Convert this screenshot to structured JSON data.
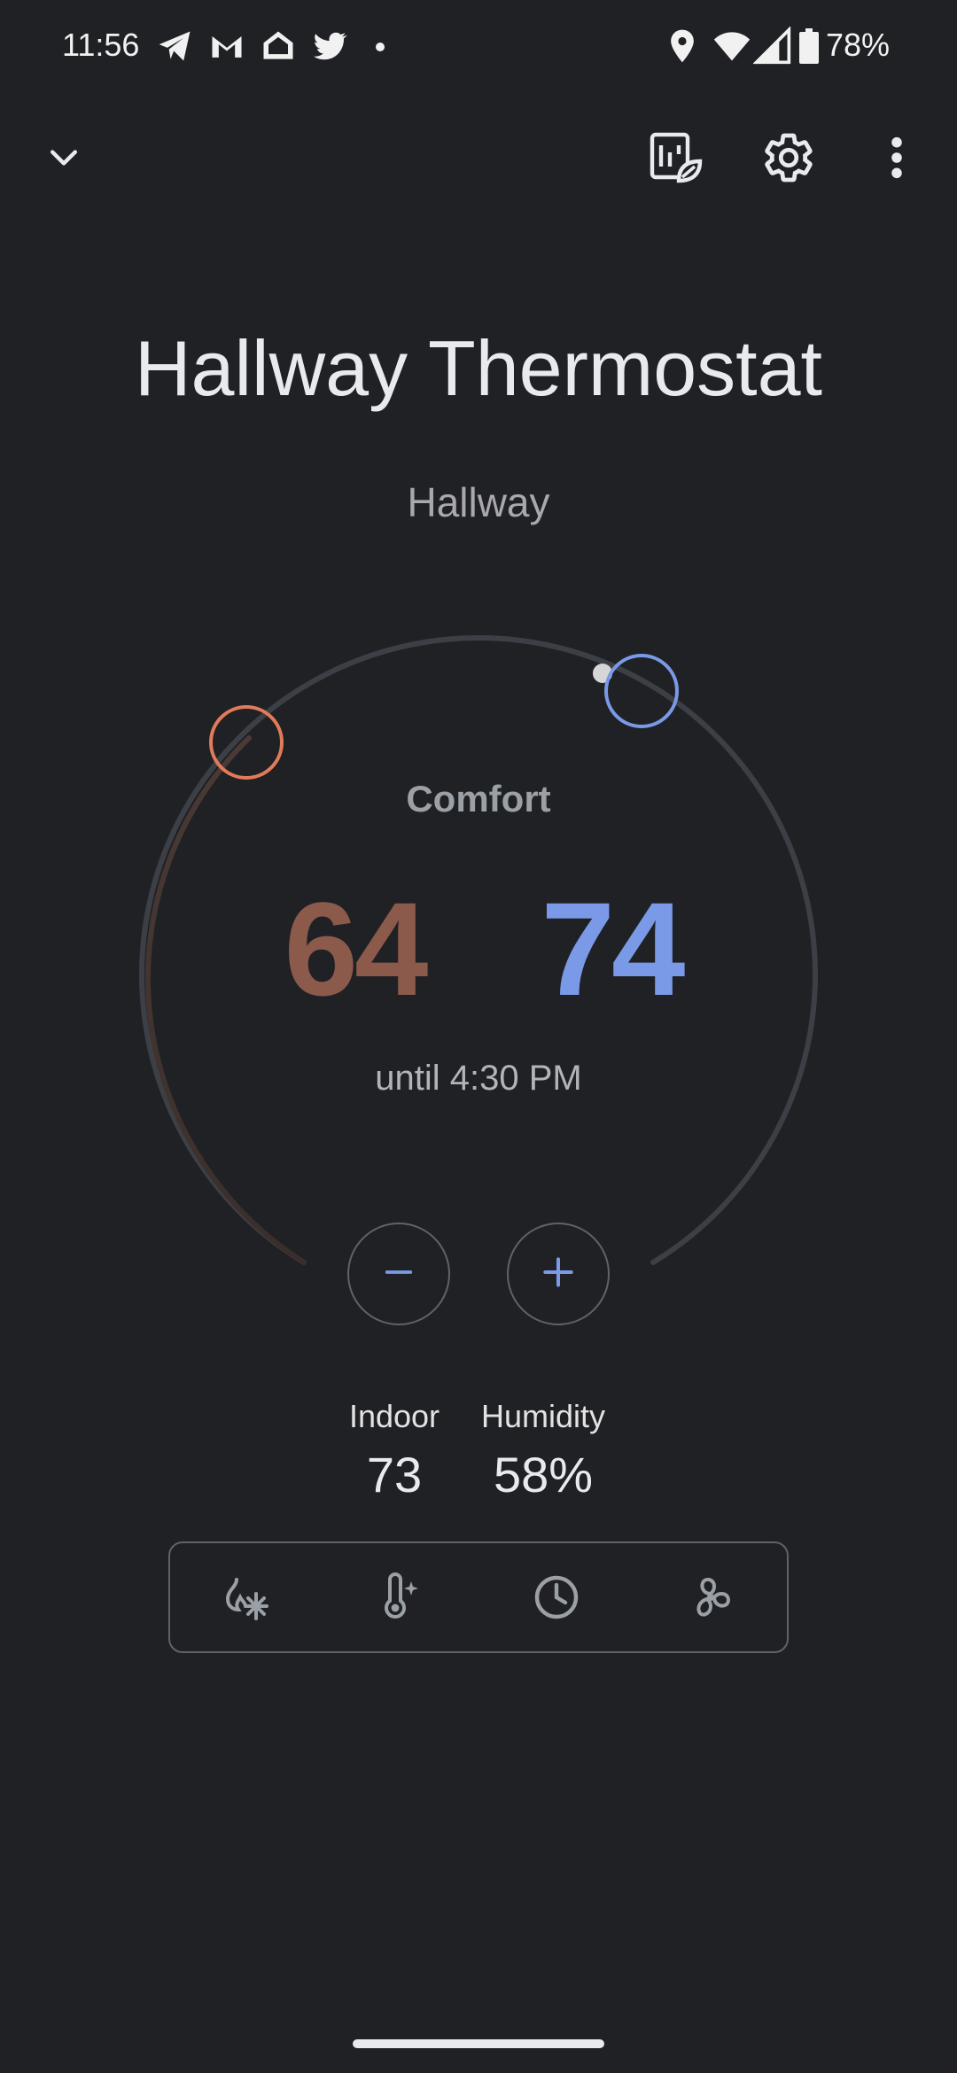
{
  "status_bar": {
    "time": "11:56",
    "battery": "78%",
    "notification_icons": [
      "telegram-icon",
      "gmail-icon",
      "google-home-icon",
      "twitter-icon",
      "dot-icon"
    ],
    "system_icons": [
      "location-icon",
      "wifi-icon",
      "signal-icon",
      "battery-icon"
    ]
  },
  "top_bar": {
    "icons": [
      "collapse-chevron-icon",
      "energy-history-icon",
      "settings-gear-icon",
      "more-vert-icon"
    ]
  },
  "device": {
    "title": "Hallway Thermostat",
    "room": "Hallway"
  },
  "dial": {
    "mode": "Comfort",
    "heat_setpoint": "64",
    "cool_setpoint": "74",
    "until": "until 4:30 PM",
    "colors": {
      "heat": "#8b5a4b",
      "heat_ring": "#e07b5b",
      "cool": "#7a9ae8",
      "track": "#3c4046"
    }
  },
  "stats": {
    "indoor_label": "Indoor",
    "indoor_value": "73",
    "humidity_label": "Humidity",
    "humidity_value": "58%"
  },
  "controls": {
    "icons": [
      "mode-heat-cool-icon",
      "eco-temperature-icon",
      "schedule-clock-icon",
      "fan-icon"
    ]
  }
}
